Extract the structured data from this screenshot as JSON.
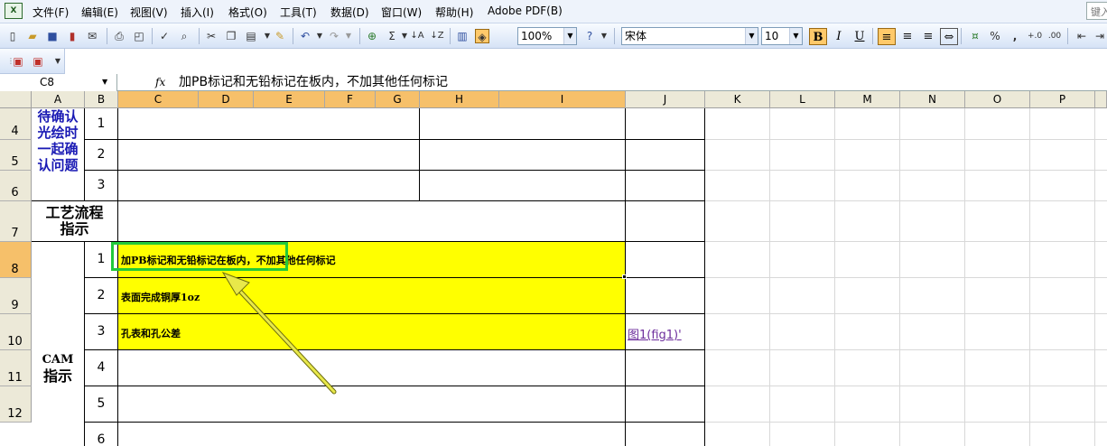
{
  "menu": {
    "items": [
      "文件(F)",
      "编辑(E)",
      "视图(V)",
      "插入(I)",
      "格式(O)",
      "工具(T)",
      "数据(D)",
      "窗口(W)",
      "帮助(H)",
      "Adobe PDF(B)"
    ],
    "help_box": "键入"
  },
  "toolbar": {
    "zoom": "100%",
    "font_name": "宋体",
    "font_size": "10",
    "bold_label": "B",
    "italic_label": "I",
    "underline_label": "U",
    "sum_label": "Σ",
    "percent_label": "%",
    "comma_label": ","
  },
  "formula_bar": {
    "name_box": "C8",
    "fx_label": "fx",
    "content": "加PB标记和无铅标记在板内，不加其他任何标记"
  },
  "columns": [
    "A",
    "B",
    "C",
    "D",
    "E",
    "F",
    "G",
    "H",
    "I",
    "J",
    "K",
    "L",
    "M",
    "N",
    "O",
    "P"
  ],
  "rows": [
    "4",
    "5",
    "6",
    "7",
    "8",
    "9",
    "10",
    "11",
    "12"
  ],
  "sheet": {
    "confirm_label": "待确认光绘时一起确认问题",
    "confirm_label_lines": [
      "待确认",
      "光绘时",
      "一起确",
      "认问题"
    ],
    "process_label_lines": [
      "工艺流程",
      "指示"
    ],
    "cam_label_lines": [
      "CAM",
      "指示"
    ],
    "confirm_numbers": [
      "1",
      "2",
      "3"
    ],
    "cam_numbers": [
      "1",
      "2",
      "3",
      "4",
      "5",
      "6"
    ],
    "cam_items": [
      "加PB标记和无铅标记在板内，不加其他任何标记",
      "表面完成铜厚1oz",
      "孔表和孔公差"
    ],
    "link_text": "图1(fig1)'",
    "highlight_color": "#ffff00",
    "selection_color": "#22c93a",
    "arrow_color": "#e8e84a"
  }
}
